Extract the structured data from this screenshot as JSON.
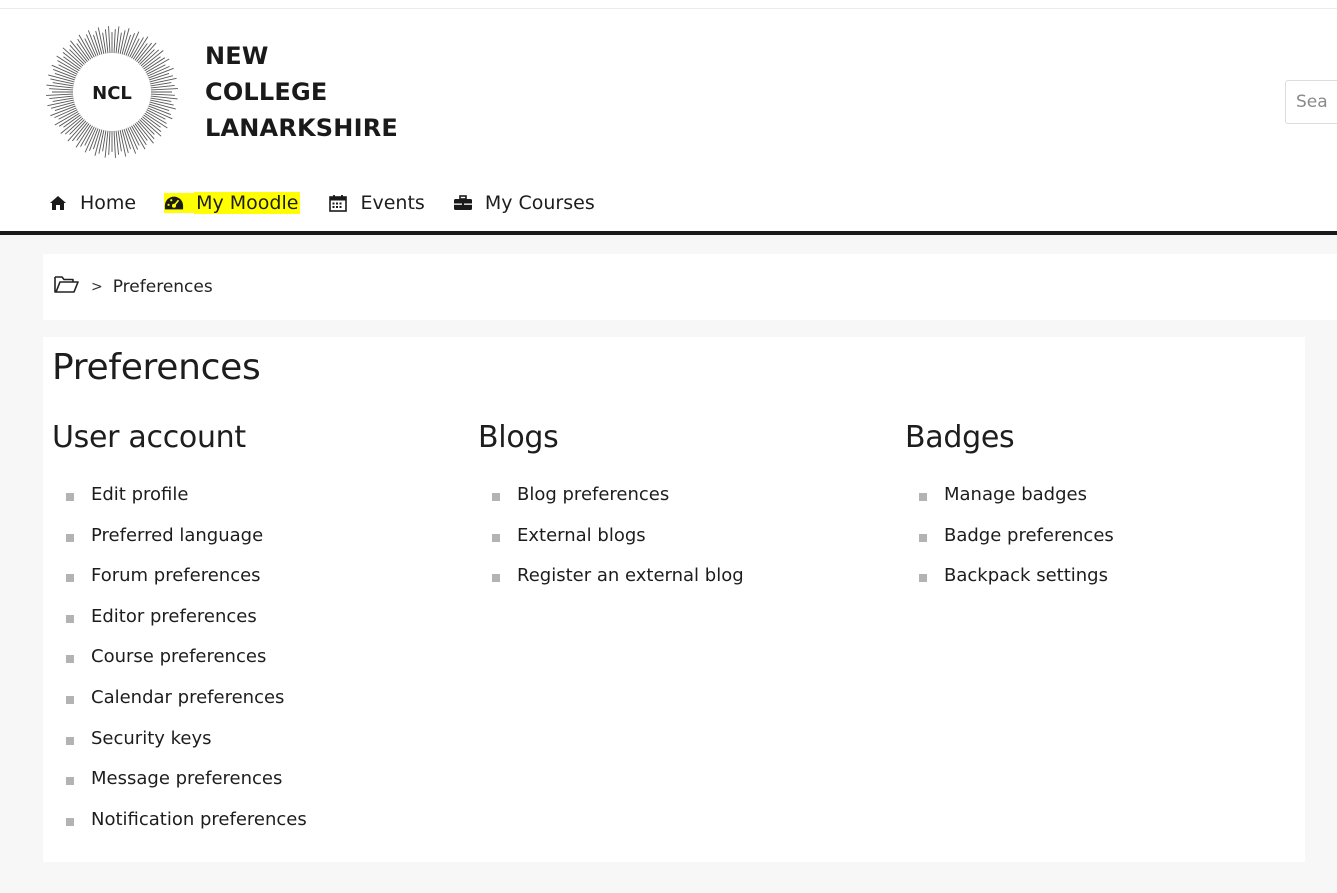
{
  "header": {
    "logo_badge": "NCL",
    "logo_lines": [
      "NEW",
      "COLLEGE",
      "LANARKSHIRE"
    ],
    "search_placeholder": "Sea"
  },
  "nav": [
    {
      "label": "Home",
      "icon": "home-icon",
      "highlighted": false
    },
    {
      "label": "My Moodle",
      "icon": "dashboard-icon",
      "highlighted": true
    },
    {
      "label": "Events",
      "icon": "calendar-icon",
      "highlighted": false
    },
    {
      "label": "My Courses",
      "icon": "briefcase-icon",
      "highlighted": false
    }
  ],
  "breadcrumb": {
    "separator": ">",
    "current": "Preferences"
  },
  "page": {
    "title": "Preferences",
    "sections": [
      {
        "heading": "User account",
        "links": [
          "Edit profile",
          "Preferred language",
          "Forum preferences",
          "Editor preferences",
          "Course preferences",
          "Calendar preferences",
          "Security keys",
          "Message preferences",
          "Notification preferences"
        ]
      },
      {
        "heading": "Blogs",
        "links": [
          "Blog preferences",
          "External blogs",
          "Register an external blog"
        ]
      },
      {
        "heading": "Badges",
        "links": [
          "Manage badges",
          "Badge preferences",
          "Backpack settings"
        ]
      }
    ]
  },
  "colors": {
    "highlight": "#ffff00",
    "header_rule": "#1a1a1a",
    "bullet": "#b3b3b3"
  }
}
